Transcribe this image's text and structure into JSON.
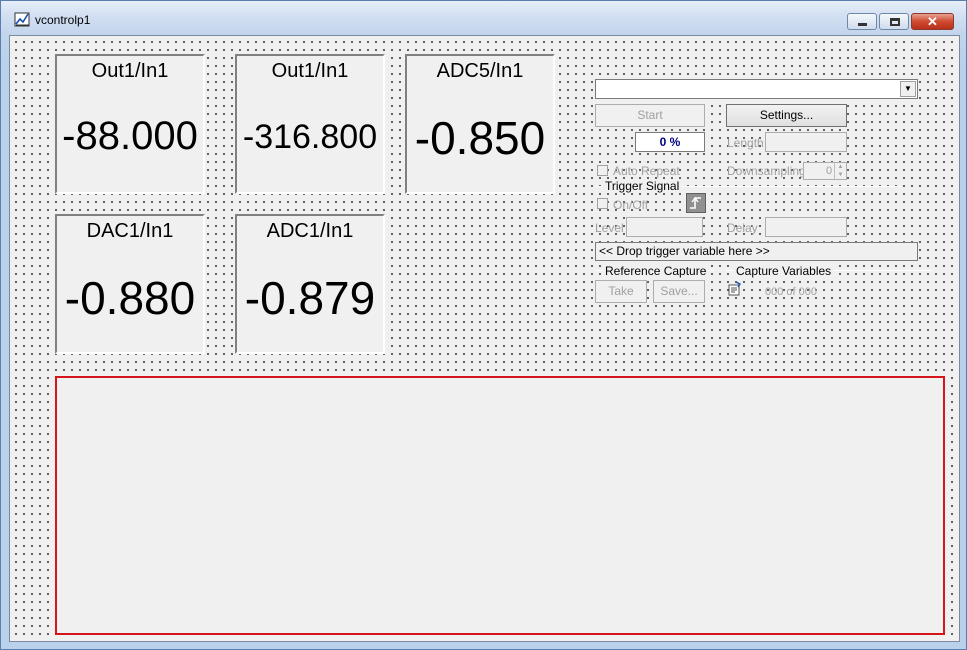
{
  "window": {
    "title": "vcontrolp1",
    "minimize": "minimize",
    "maximize": "maximize",
    "close": "close"
  },
  "gauges": [
    {
      "title": "Out1/In1",
      "value": "-88.000"
    },
    {
      "title": "Out1/In1",
      "value": "-316.800"
    },
    {
      "title": "ADC5/In1",
      "value": "-0.850"
    },
    {
      "title": "DAC1/In1",
      "value": "-0.880"
    },
    {
      "title": "ADC1/In1",
      "value": "-0.879"
    }
  ],
  "capture": {
    "source_select_value": "",
    "start_label": "Start",
    "settings_label": "Settings...",
    "progress_text": "0 %",
    "length_label": "Length",
    "length_value": "",
    "auto_repeat_label": "Auto Repeat",
    "downsampling_label": "Downsampling",
    "downsampling_value": "0"
  },
  "trigger": {
    "group_label": "Trigger Signal",
    "onoff_label": "On/Off",
    "level_label": "Level",
    "level_value": "",
    "delay_label": "Delay",
    "delay_value": "",
    "drop_text": "<< Drop trigger variable here >>"
  },
  "reference": {
    "group_label": "Reference Capture",
    "take_label": "Take",
    "save_label": "Save..."
  },
  "capture_variables": {
    "group_label": "Capture Variables",
    "count_text": "000 of 000"
  },
  "colors": {
    "plot_border": "#d6141c",
    "progress_text": "#000080"
  }
}
